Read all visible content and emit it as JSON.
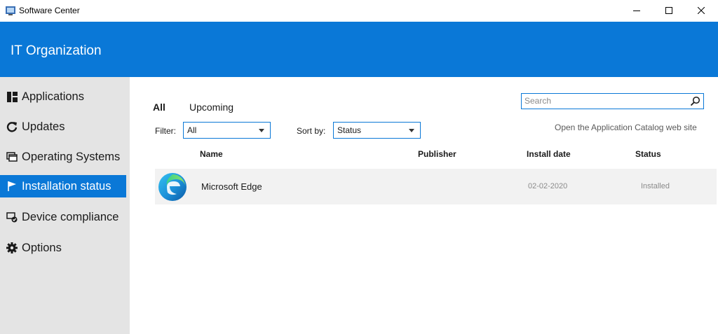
{
  "window": {
    "title": "Software Center",
    "controls": [
      "minimize",
      "maximize",
      "close"
    ]
  },
  "header": {
    "organization": "IT Organization",
    "background": "#0a78d7"
  },
  "sidebar": {
    "items": [
      {
        "label": "Applications",
        "icon": "applications-grid-icon",
        "active": false
      },
      {
        "label": "Updates",
        "icon": "refresh-icon",
        "active": false
      },
      {
        "label": "Operating Systems",
        "icon": "windows-stack-icon",
        "active": false
      },
      {
        "label": "Installation status",
        "icon": "flag-icon",
        "active": true
      },
      {
        "label": "Device compliance",
        "icon": "compliance-icon",
        "active": false
      },
      {
        "label": "Options",
        "icon": "gear-icon",
        "active": false
      }
    ]
  },
  "main": {
    "tabs": [
      {
        "label": "All",
        "active": true
      },
      {
        "label": "Upcoming",
        "active": false
      }
    ],
    "search": {
      "placeholder": "Search"
    },
    "filter": {
      "label": "Filter:",
      "value": "All"
    },
    "sort": {
      "label": "Sort by:",
      "value": "Status"
    },
    "catalog_link": "Open the Application Catalog web site",
    "columns": [
      "Name",
      "Publisher",
      "Install date",
      "Status"
    ],
    "rows": [
      {
        "icon": "microsoft-edge-icon",
        "name": "Microsoft Edge",
        "publisher": "",
        "install_date": "02-02-2020",
        "status": "Installed"
      }
    ]
  },
  "colors": {
    "accent": "#0a78d7",
    "sidebar_bg": "#e4e4e4",
    "row_bg": "#f2f2f2"
  }
}
